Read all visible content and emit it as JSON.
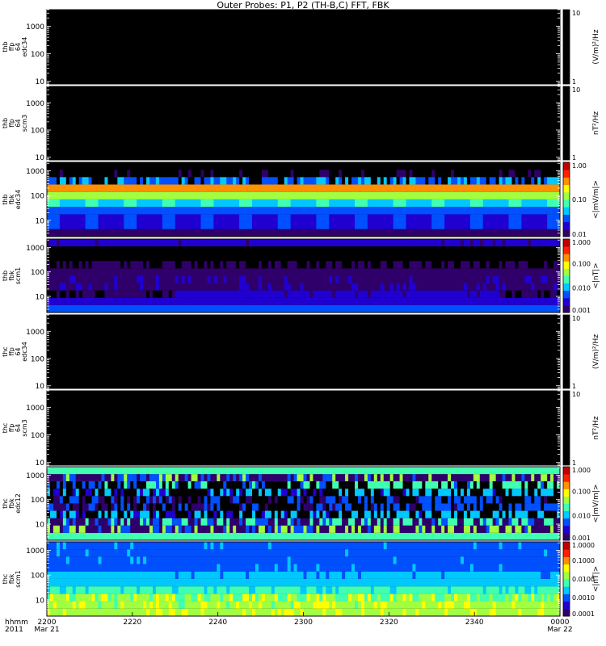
{
  "title": "Outer Probes: P1, P2 (TH-B,C) FFT, FBK",
  "xaxis": {
    "row_labels": [
      "hhmm",
      "2011"
    ],
    "ticks": [
      {
        "label": "2200",
        "sub": "Mar 21",
        "t": 0
      },
      {
        "label": "2220",
        "sub": "",
        "t": 20
      },
      {
        "label": "2240",
        "sub": "",
        "t": 40
      },
      {
        "label": "2300",
        "sub": "",
        "t": 60
      },
      {
        "label": "2320",
        "sub": "",
        "t": 80
      },
      {
        "label": "2340",
        "sub": "",
        "t": 100
      },
      {
        "label": "0000",
        "sub": "Mar 22",
        "t": 120
      }
    ],
    "range_minutes": [
      0,
      120
    ]
  },
  "colors": {
    "background": "#000000",
    "frame": "#ffffff",
    "colorbar": [
      "#30006a",
      "#2000d0",
      "#0050ff",
      "#00c8ff",
      "#40ffb0",
      "#a0ff40",
      "#ffff00",
      "#ff9000",
      "#ff2000",
      "#c00000"
    ]
  },
  "chart_data": [
    {
      "type": "heatmap",
      "name": "tha_ffp_64_edc34",
      "ylabel": [
        "thb",
        "ffp",
        "64",
        "edc34"
      ],
      "yscale": "log",
      "yticks": [
        "10",
        "100",
        "1000"
      ],
      "ylim": [
        8,
        4000
      ],
      "zlabel": "(V/m)²/Hz",
      "zticks": [
        "1",
        "10"
      ],
      "zscale": "log",
      "fill": "empty",
      "pattern": null
    },
    {
      "type": "heatmap",
      "name": "thb_ffp_64_scm3",
      "ylabel": [
        "thb",
        "ffp",
        "64",
        "scm3"
      ],
      "yscale": "log",
      "yticks": [
        "10",
        "100",
        "1000"
      ],
      "ylim": [
        8,
        4000
      ],
      "zlabel": "nT²/Hz",
      "zticks": [
        "1",
        "10"
      ],
      "zscale": "log",
      "fill": "empty",
      "pattern": null
    },
    {
      "type": "heatmap",
      "name": "thb_fbk_edc34",
      "ylabel": [
        "thb",
        "fbk",
        "edc34"
      ],
      "yscale": "log",
      "yticks": [
        "10",
        "100",
        "1000"
      ],
      "ylim": [
        2.2,
        2200
      ],
      "zlabel": "<|mV/m|>",
      "zticks": [
        "0.01",
        "0.10",
        "1.00"
      ],
      "zscale": "log",
      "fill": "bands",
      "pattern": "fbk_b",
      "bands_hz": [
        2.2,
        4.4,
        8.8,
        17.5,
        35,
        70,
        140,
        280,
        560,
        1100,
        2200
      ],
      "levels": [
        0.01,
        0.012,
        0.015,
        0.02,
        0.05,
        0.1,
        0.4,
        0.02,
        0.003,
        0.002
      ]
    },
    {
      "type": "heatmap",
      "name": "thb_fbk_scm1",
      "ylabel": [
        "thb",
        "fbk",
        "scm1"
      ],
      "yscale": "log",
      "yticks": [
        "10",
        "100",
        "1000"
      ],
      "ylim": [
        2.2,
        2200
      ],
      "zlabel": "<|nT|>",
      "zticks": [
        "0.001",
        "0.010",
        "0.100",
        "1.000"
      ],
      "zscale": "log",
      "fill": "bands",
      "pattern": "fbk_b_scm",
      "bands_hz": [
        2.2,
        4.4,
        8.8,
        17.5,
        35,
        70,
        140,
        280,
        560,
        1100,
        2200
      ],
      "levels": [
        0.0045,
        0.0025,
        0.0015,
        0.0012,
        0.0012,
        0.0008,
        0.0006,
        0.0005,
        0.0005,
        0.0015
      ]
    },
    {
      "type": "heatmap",
      "name": "thc_ffp_64_edc34",
      "ylabel": [
        "thc",
        "ffp",
        "64",
        "edc34"
      ],
      "yscale": "log",
      "yticks": [
        "10",
        "100",
        "1000"
      ],
      "ylim": [
        8,
        4000
      ],
      "zlabel": "(V/m)²/Hz",
      "zticks": [
        "1",
        "10"
      ],
      "zscale": "log",
      "fill": "empty",
      "pattern": null
    },
    {
      "type": "heatmap",
      "name": "thc_ffp_64_scm3",
      "ylabel": [
        "thc",
        "ffp",
        "64",
        "scm3"
      ],
      "yscale": "log",
      "yticks": [
        "10",
        "100",
        "1000"
      ],
      "ylim": [
        8,
        4000
      ],
      "zlabel": "nT²/Hz",
      "zticks": [
        "1",
        "10"
      ],
      "zscale": "log",
      "fill": "empty",
      "pattern": null
    },
    {
      "type": "heatmap",
      "name": "thc_fbk_edc12",
      "ylabel": [
        "thc",
        "fbk",
        "edc12"
      ],
      "yscale": "log",
      "yticks": [
        "10",
        "100",
        "1000"
      ],
      "ylim": [
        2.2,
        2200
      ],
      "zlabel": "<|mV/m|>",
      "zticks": [
        "0.001",
        "0.010",
        "0.100",
        "1.000"
      ],
      "zscale": "log",
      "fill": "bands",
      "pattern": "fbk_c",
      "bands_hz": [
        2.2,
        4.4,
        8.8,
        17.5,
        35,
        70,
        140,
        280,
        560,
        1100,
        2200
      ],
      "levels": [
        0.02,
        0.003,
        0.002,
        0.0008,
        0.0005,
        0.0005,
        0.0008,
        0.0015,
        0.003,
        0.02
      ]
    },
    {
      "type": "heatmap",
      "name": "thc_fbk_scm1",
      "ylabel": [
        "thc",
        "fbk",
        "scm1"
      ],
      "yscale": "log",
      "yticks": [
        "10",
        "100",
        "1000"
      ],
      "ylim": [
        2.2,
        2200
      ],
      "zlabel": "<|nT|>",
      "zticks": [
        "0.0001",
        "0.0010",
        "0.0100",
        "0.1000",
        "1.0000"
      ],
      "zscale": "log",
      "fill": "bands",
      "pattern": "fbk_c_scm",
      "bands_hz": [
        2.2,
        4.4,
        8.8,
        17.5,
        35,
        70,
        140,
        280,
        560,
        1100,
        2200
      ],
      "levels": [
        0.02,
        0.012,
        0.01,
        0.004,
        0.0025,
        0.0015,
        0.001,
        0.001,
        0.001,
        0.001
      ]
    }
  ]
}
